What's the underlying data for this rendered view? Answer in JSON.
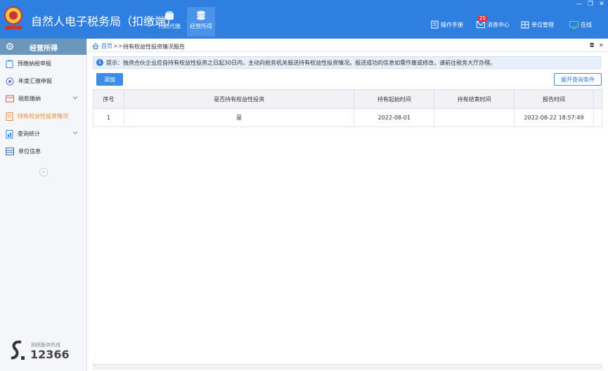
{
  "app": {
    "title": "自然人电子税务局（扣缴端）",
    "modules": [
      {
        "label": "代扣代缴",
        "icon": "wallet-icon"
      },
      {
        "label": "经营所得",
        "icon": "coins-icon",
        "active": true
      }
    ],
    "toolbar": {
      "manual_label": "操作手册",
      "messages_label": "消息中心",
      "messages_badge": "25",
      "unit_label": "单位管理",
      "online_label": "在线"
    },
    "window_controls": {
      "minimize": "—",
      "restore": "❐",
      "close": "✕"
    }
  },
  "sidebar": {
    "title": "经营所得",
    "items": [
      {
        "label": "预缴纳税申报",
        "icon": "clipboard-icon"
      },
      {
        "label": "年度汇缴申报",
        "icon": "settings-circle-icon"
      },
      {
        "label": "税款缴纳",
        "icon": "payment-icon",
        "expandable": true
      },
      {
        "label": "持有权益性投资情况",
        "icon": "document-icon",
        "active": true
      },
      {
        "label": "查询统计",
        "icon": "report-icon",
        "expandable": true
      },
      {
        "label": "单位信息",
        "icon": "table-icon"
      }
    ],
    "collapse_glyph": "«",
    "hotline_label": "纳税服务热线",
    "hotline_number": "12366"
  },
  "breadcrumb": {
    "home": "首页",
    "separator": ">>",
    "current": "持有权益性投资情况报告",
    "restore_glyph": "◘",
    "close_glyph": "✕"
  },
  "notice": {
    "info_glyph": "i",
    "text": "提示：独资合伙企业应自持有权益性投资之日起30日内，主动向税务机关报送持有权益性投资情况。报送成功的信息如需作废或修改，请前往税务大厅办理。"
  },
  "actions": {
    "add_label": "添加",
    "expand_label": "展开查询条件"
  },
  "table": {
    "columns": [
      "序号",
      "是否持有权益性投资",
      "持有起始时间",
      "持有结束时间",
      "报告时间"
    ],
    "rows": [
      [
        "1",
        "是",
        "2022-08-01",
        "",
        "2022-08-22 18:57:49"
      ]
    ]
  },
  "colors": {
    "primary": "#2f7fe0",
    "sidebar_head": "#6c97bd",
    "active_nav": "#f08b2c"
  }
}
